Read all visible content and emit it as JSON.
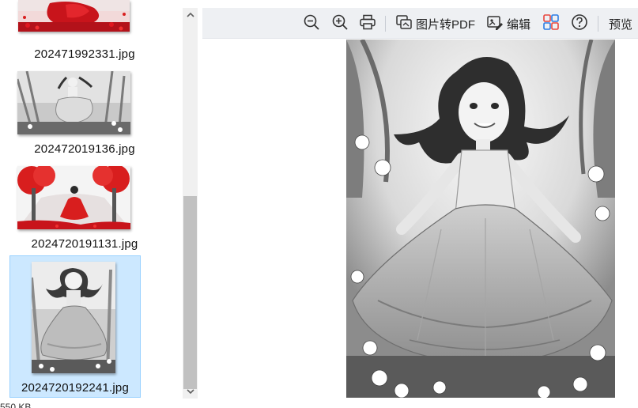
{
  "thumbnails": [
    {
      "filename": "202471992331.jpg",
      "icon": "red-field-image"
    },
    {
      "filename": "202472019136.jpg",
      "icon": "girl-dancing-grayscale-image"
    },
    {
      "filename": "2024720191131.jpg",
      "icon": "girl-red-dress-trees-image"
    },
    {
      "filename": "2024720192241.jpg",
      "icon": "girl-portrait-grayscale-image",
      "selected": true
    }
  ],
  "status": {
    "size_text": "550 KB"
  },
  "toolbar": {
    "zoom_out_icon": "zoom-out-icon",
    "zoom_in_icon": "zoom-in-icon",
    "print_icon": "print-icon",
    "to_pdf_label": "图片转PDF",
    "edit_label": "编辑",
    "apps_icon": "apps-grid-icon",
    "help_icon": "help-icon",
    "preview_label": "预览"
  },
  "colors": {
    "selection_bg": "#cce8ff",
    "selection_border": "#99d1ff",
    "toolbar_bg": "#eef0f3",
    "scroll_thumb": "#c1c1c1",
    "accent_red": "#d81e1e"
  },
  "preview": {
    "subject": "girl-portrait-grayscale-image"
  }
}
